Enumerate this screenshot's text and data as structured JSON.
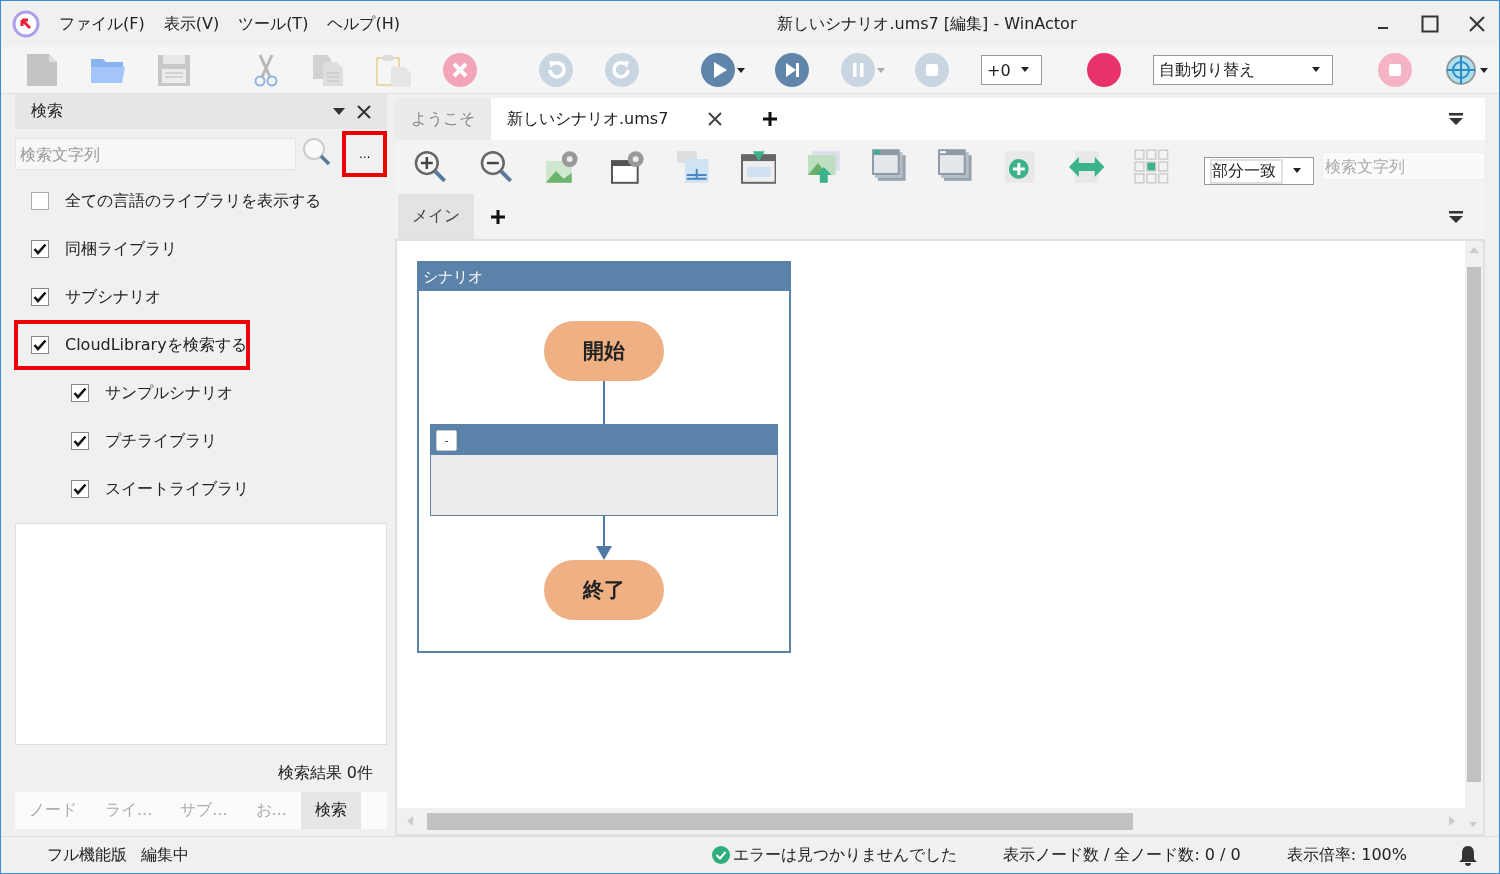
{
  "window": {
    "title": "新しいシナリオ.ums7 [編集] - WinActor"
  },
  "menu": [
    "ファイル(F)",
    "表示(V)",
    "ツール(T)",
    "ヘルプ(H)"
  ],
  "toolbar": {
    "speed": "+0",
    "record_mode": "自動切り替え"
  },
  "search_panel": {
    "title": "検索",
    "search": {
      "placeholder": "検索文字列"
    },
    "more_button": {
      "label": "…",
      "highlighted": true
    },
    "options": [
      {
        "label": "全ての言語のライブラリを表示する",
        "checked": false,
        "highlighted": false
      },
      {
        "label": "同梱ライブラリ",
        "checked": true,
        "highlighted": false
      },
      {
        "label": "サブシナリオ",
        "checked": true,
        "highlighted": false
      },
      {
        "label": "CloudLibraryを検索する",
        "checked": true,
        "highlighted": true,
        "children": [
          {
            "label": "サンプルシナリオ",
            "checked": true,
            "highlighted": false
          },
          {
            "label": "プチライブラリ",
            "checked": true,
            "highlighted": false
          },
          {
            "label": "スイートライブラリ",
            "checked": true,
            "highlighted": false
          }
        ]
      }
    ],
    "result": "検索結果 0件",
    "tabs": [
      {
        "label": "ノード",
        "selected": false
      },
      {
        "label": "ライ...",
        "selected": false
      },
      {
        "label": "サブ...",
        "selected": false
      },
      {
        "label": "お...",
        "selected": false
      },
      {
        "label": "検索",
        "selected": true
      }
    ]
  },
  "editor": {
    "tabs": [
      {
        "label": "ようこそ",
        "selected": false
      },
      {
        "label": "新しいシナリオ.ums7",
        "selected": true
      }
    ],
    "match_mode": "部分一致",
    "search": {
      "placeholder": "検索文字列"
    },
    "sheet_tabs": [
      {
        "label": "メイン",
        "selected": true
      }
    ],
    "scenario": {
      "title": "シナリオ",
      "nodes": [
        {
          "kind": "terminal",
          "label": "開始"
        },
        {
          "kind": "group",
          "toggle": "-"
        },
        {
          "kind": "terminal",
          "label": "終了"
        }
      ]
    }
  },
  "status_bar": {
    "edition": "フル機能版",
    "mode": "編集中",
    "check": "エラーは見つかりませんでした",
    "node_count": "表示ノード数 / 全ノード数: 0 / 0",
    "zoom": "表示倍率: 100%"
  }
}
